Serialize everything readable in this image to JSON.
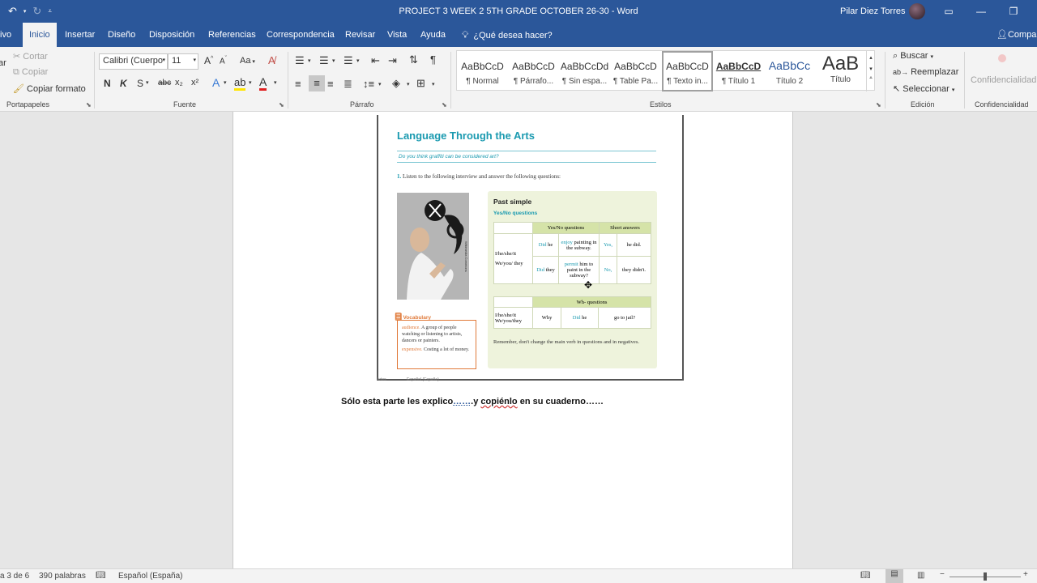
{
  "titlebar": {
    "title": "PROJECT 3 WEEK 2   5TH GRADE  OCTOBER 26-30  -  Word",
    "user": "Pilar Diez Torres"
  },
  "tabs": [
    "ivo",
    "Inicio",
    "Insertar",
    "Diseño",
    "Disposición",
    "Referencias",
    "Correspondencia",
    "Revisar",
    "Vista",
    "Ayuda"
  ],
  "tellme": "¿Qué desea hacer?",
  "share": "Compar",
  "clipboard": {
    "cut": "Cortar",
    "copy": "Copiar",
    "format_painter": "Copiar formato",
    "label": "Portapapeles",
    "paste_partial": "ar"
  },
  "font": {
    "name": "Calibri (Cuerpo",
    "size": "11",
    "label": "Fuente",
    "bold": "N",
    "italic": "K",
    "underline": "S",
    "strike": "abc",
    "sub": "x₂",
    "sup": "x²",
    "grow": "A^",
    "shrink": "A˅",
    "case": "Aa"
  },
  "paragraph": {
    "label": "Párrafo"
  },
  "styles": {
    "label": "Estilos",
    "items": [
      {
        "sample": "AaBbCcD",
        "name": "¶ Normal"
      },
      {
        "sample": "AaBbCcD",
        "name": "¶ Párrafo..."
      },
      {
        "sample": "AaBbCcDd",
        "name": "¶ Sin espa..."
      },
      {
        "sample": "AaBbCcD",
        "name": "¶ Table Pa..."
      },
      {
        "sample": "AaBbCcD",
        "name": "¶ Texto in..."
      },
      {
        "sample": "AaBbCcD",
        "name": "¶ Título 1"
      },
      {
        "sample": "AaBbCc",
        "name": "Título 2"
      },
      {
        "sample": "AaB",
        "name": "Título"
      }
    ]
  },
  "editing": {
    "find": "Buscar",
    "replace": "Reemplazar",
    "select": "Seleccionar",
    "label": "Edición"
  },
  "sensitivity": {
    "button": "Confidencialidad",
    "label": "Confidencialidad"
  },
  "figure": {
    "heading": "Language Through the Arts",
    "question": "Do you think graffiti can be considered art?",
    "task_num": "1.",
    "task": "Listen to the following interview and answer the following questions:",
    "photo_credit": "Wikimedia Commons",
    "vocab": {
      "title": "Vocabulary",
      "w1": "audience.",
      "d1": "A group of people watching or listening to artists, dancers or painters.",
      "w2": "expensive.",
      "d2": "Costing a lot of money."
    },
    "grammar": {
      "title": "Past simple",
      "subtitle": "Yes/No questions",
      "yn_header": "Yes/No questions",
      "sa_header": "Short answers",
      "subj1": "I/he/she/it",
      "subj2": "We/you/ they",
      "did1": "Did",
      "he": "he",
      "did2": "Did",
      "they": "they",
      "verb1": "enjoy",
      "rest1": "painting in the subway.",
      "verb2": "permit",
      "rest2": "him to paint in the subway?",
      "yes": "Yes,",
      "yes_ans": "he did.",
      "no": "No,",
      "no_ans": "they didn't.",
      "wh_header": "Wh- questions",
      "wh_subj": "I/he/she/it We/you/they",
      "why": "Why",
      "did3": "Did",
      "he3": "he",
      "jail": "go to jail?",
      "note": "Remember, don't change the main verb in questions and in negatives."
    },
    "footer_left": "Artes",
    "footer_right": "Español (España)"
  },
  "body": {
    "line_a": "Sólo esta parte les explico",
    "dots": "……",
    "line_b": ".y ",
    "copienlo": "copiénlo",
    "line_c": " en su cuaderno……"
  },
  "status": {
    "page": "a 3 de 6",
    "words": "390 palabras",
    "language": "Español (España)"
  },
  "colors": {
    "word_blue": "#2b579a",
    "teal": "#1a9ab0",
    "accent_orange": "#e07a3a",
    "grammar_green": "#eef3dc"
  }
}
